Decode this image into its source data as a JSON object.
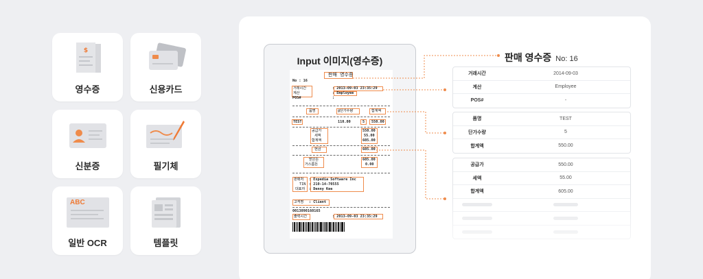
{
  "categories": [
    {
      "label": "영수증",
      "icon": "receipt-icon"
    },
    {
      "label": "신용카드",
      "icon": "credit-card-icon"
    },
    {
      "label": "신분증",
      "icon": "id-card-icon"
    },
    {
      "label": "필기체",
      "icon": "handwriting-icon"
    },
    {
      "label": "일반 OCR",
      "icon": "document-icon",
      "badge": "ABC"
    },
    {
      "label": "템플릿",
      "icon": "template-icon"
    }
  ],
  "input": {
    "title": "Input 이미지(영수증)"
  },
  "receipt": {
    "title": "판매 영수증",
    "no": "No : 16",
    "datetime_label": "거래시간",
    "datetime_value": ": 2013-09-03 23:35:29",
    "cashier_label": "계산",
    "cashier_value": ": Employee",
    "pos_label": "POS#",
    "pos_value": ":",
    "col_item": "품명",
    "col_price": "@단가수량",
    "col_total": "합계액",
    "item_name": "TEST",
    "item_price": "110.00",
    "item_qty": "5",
    "item_total": "550.00",
    "supply_label": "공급가",
    "supply_value": "550.00",
    "tax_label": "세액",
    "tax_value": "55.00",
    "sum_label": "합계액",
    "sum_value": "605.00",
    "cash_label": "현금",
    "cash_value": "605.00",
    "received_label": "받은돈",
    "received_value": "605.00",
    "change_label": "거스름돈",
    "change_value": "0.00",
    "merchant_label": "판매처",
    "merchant_value": ": Expedia Software Inc",
    "tin_label": "TIN",
    "tin_value": ": 210-14-70555",
    "rep_label": "대표자",
    "rep_value": ": Denny Kee",
    "customer_label": "고객명",
    "customer_value": ": Client",
    "barcode_no": "0013090160165",
    "print_label": "출력시간",
    "print_value": ": 2013-09-03 23:35:29"
  },
  "result": {
    "title": "판매 영수증",
    "no": "No: 16",
    "group1": [
      {
        "k": "거래시간",
        "v": "2014-09-03"
      },
      {
        "k": "계산",
        "v": "Employee"
      },
      {
        "k": "POS#",
        "v": "-"
      }
    ],
    "group2": [
      {
        "k": "품명",
        "v": "TEST"
      },
      {
        "k": "단가수량",
        "v": "5"
      },
      {
        "k": "합계액",
        "v": "550.00"
      }
    ],
    "group3": [
      {
        "k": "공급가",
        "v": "550.00"
      },
      {
        "k": "세액",
        "v": "55.00"
      },
      {
        "k": "합계액",
        "v": "605.00"
      }
    ]
  },
  "colors": {
    "accent": "#ef8b4b",
    "background": "#eeeff2"
  }
}
